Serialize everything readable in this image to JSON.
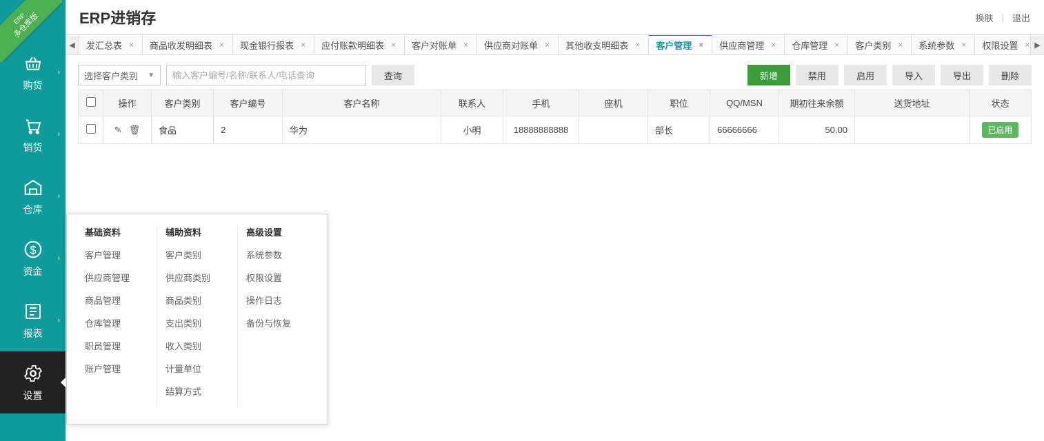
{
  "ribbon": {
    "line1": "ERP",
    "line2": "多仓库版"
  },
  "header": {
    "title": "ERP进销存",
    "skin": "换肤",
    "logout": "退出"
  },
  "sidebar": [
    {
      "label": "购货",
      "icon": "basket"
    },
    {
      "label": "销货",
      "icon": "cart"
    },
    {
      "label": "仓库",
      "icon": "warehouse"
    },
    {
      "label": "资金",
      "icon": "money"
    },
    {
      "label": "报表",
      "icon": "report"
    },
    {
      "label": "设置",
      "icon": "gear",
      "active": true
    }
  ],
  "tabs": [
    {
      "label": "发汇总表"
    },
    {
      "label": "商品收发明细表"
    },
    {
      "label": "现金银行报表"
    },
    {
      "label": "应付账款明细表"
    },
    {
      "label": "客户对账单"
    },
    {
      "label": "供应商对账单"
    },
    {
      "label": "其他收支明细表"
    },
    {
      "label": "客户管理",
      "active": true
    },
    {
      "label": "供应商管理"
    },
    {
      "label": "仓库管理"
    },
    {
      "label": "客户类别"
    },
    {
      "label": "系统参数"
    },
    {
      "label": "权限设置"
    }
  ],
  "toolbar": {
    "category_placeholder": "选择客户类别",
    "search_placeholder": "输入客户编号/名称/联系人/电话查询",
    "query": "查询",
    "add": "新增",
    "disable": "禁用",
    "enable": "启用",
    "import": "导入",
    "export": "导出",
    "delete": "删除"
  },
  "table": {
    "headers": {
      "op": "操作",
      "cat": "客户类别",
      "code": "客户编号",
      "name": "客户名称",
      "contact": "联系人",
      "mobile": "手机",
      "phone": "座机",
      "title": "职位",
      "qq": "QQ/MSN",
      "balance": "期初往来余额",
      "address": "送货地址",
      "status": "状态"
    },
    "rows": [
      {
        "cat": "食品",
        "code": "2",
        "name": "华为",
        "contact": "小明",
        "mobile": "18888888888",
        "phone": "",
        "title": "部长",
        "qq": "66666666",
        "balance": "50.00",
        "address": "",
        "status": "已启用"
      }
    ]
  },
  "settings_popup": {
    "cols": [
      {
        "title": "基础资料",
        "items": [
          "客户管理",
          "供应商管理",
          "商品管理",
          "仓库管理",
          "职员管理",
          "账户管理"
        ]
      },
      {
        "title": "辅助资料",
        "items": [
          "客户类别",
          "供应商类别",
          "商品类别",
          "支出类别",
          "收入类别",
          "计量单位",
          "结算方式"
        ]
      },
      {
        "title": "高级设置",
        "items": [
          "系统参数",
          "权限设置",
          "操作日志",
          "备份与恢复"
        ]
      }
    ]
  }
}
